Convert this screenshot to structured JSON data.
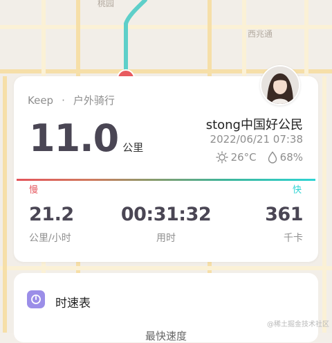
{
  "map": {
    "labels": {
      "top": "桃园",
      "right": "西兆通"
    }
  },
  "activity": {
    "app": "Keep",
    "separator": "·",
    "type": "户外骑行",
    "distance_value": "11.0",
    "distance_unit": "公里"
  },
  "user": {
    "name": "stong中国好公民",
    "datetime": "2022/06/21 07:38"
  },
  "weather": {
    "temperature": "26°C",
    "humidity": "68%",
    "icons": [
      "sun-icon",
      "droplet-icon"
    ]
  },
  "speed_bar": {
    "slow_label": "慢",
    "fast_label": "快",
    "colors": [
      "#e4545b",
      "#2ed4d4"
    ]
  },
  "stats": {
    "speed": {
      "value": "21.2",
      "label": "公里/小时"
    },
    "duration": {
      "value": "00:31:32",
      "label": "用时"
    },
    "calories": {
      "value": "361",
      "label": "千卡"
    }
  },
  "speedometer_card": {
    "title": "时速表",
    "subtitle": "最快速度",
    "icon": "speedometer-icon",
    "accent": "#9b8ee8"
  },
  "watermark": "@稀土掘金技术社区",
  "colors": {
    "route": "#5ecfc9",
    "route_start": "#e85b5f",
    "value_text": "#4a4654"
  }
}
